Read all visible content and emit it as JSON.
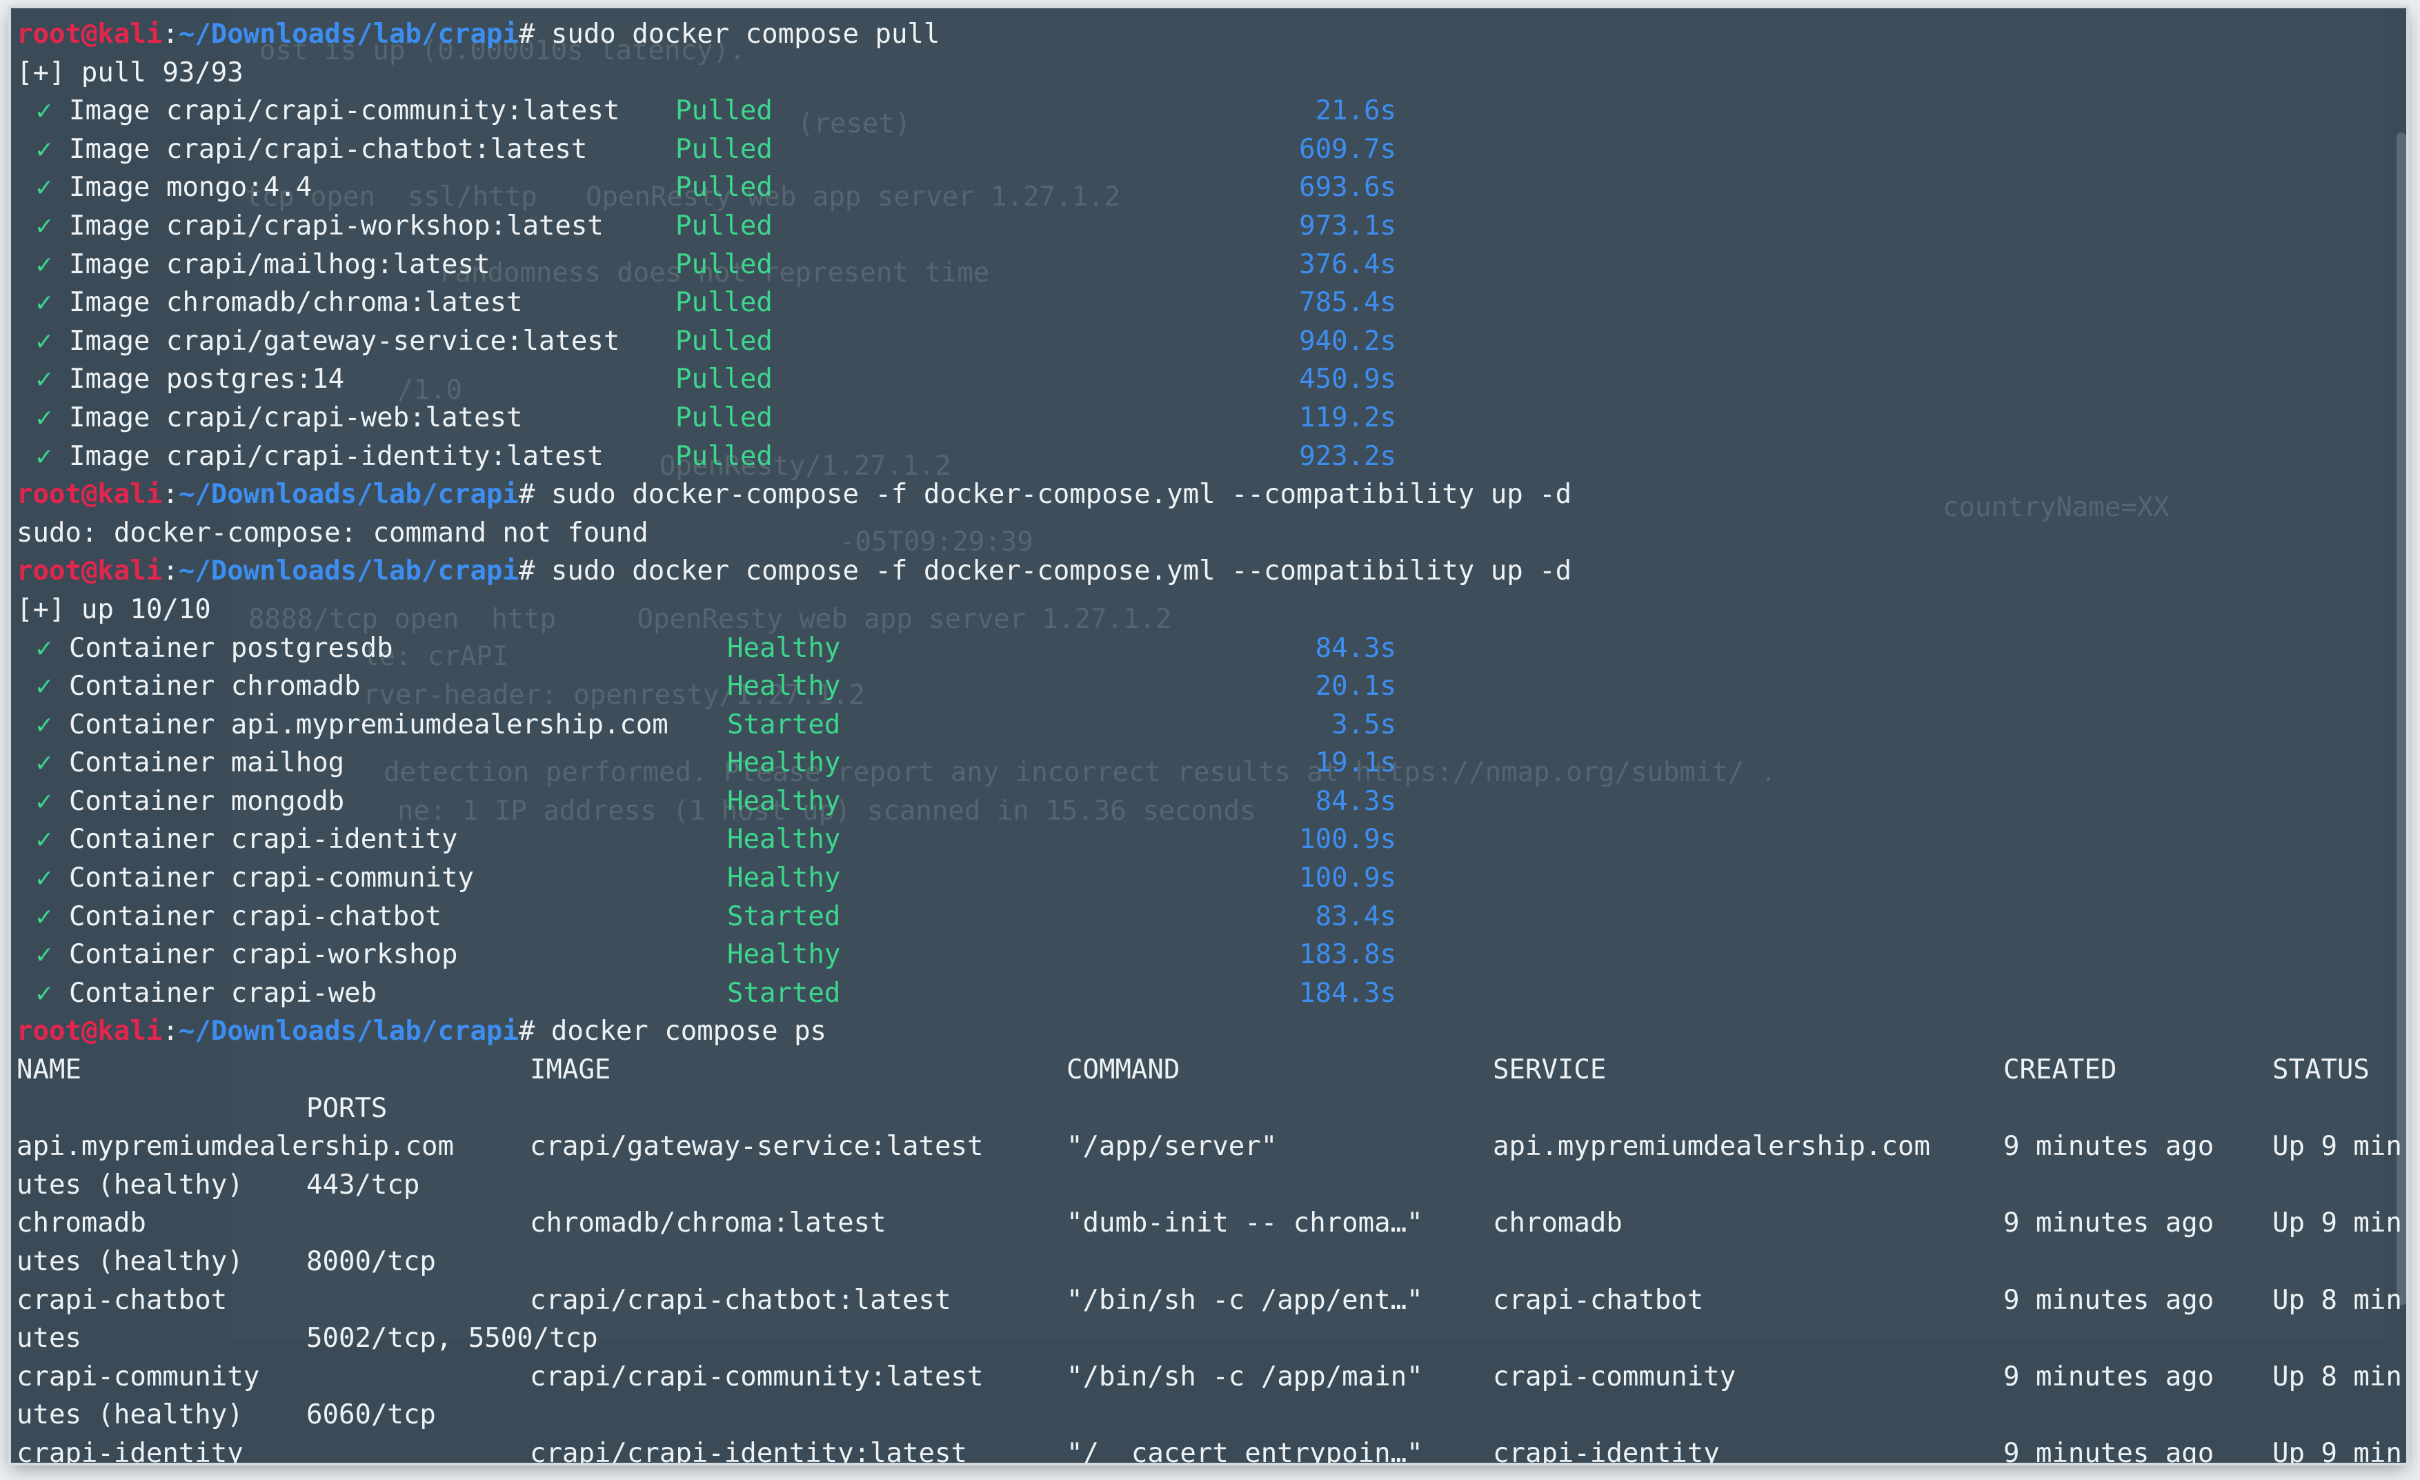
{
  "prompt": {
    "user": "root@kali",
    "sep": ":",
    "path": "~/Downloads/lab/crapi",
    "hash": "#"
  },
  "cmd1": " sudo docker compose pull",
  "pull_summary": "[+] pull 93/93",
  "pulled_images": [
    {
      "name": "Image crapi/crapi-community:latest",
      "status": "Pulled",
      "time": "21.6s"
    },
    {
      "name": "Image crapi/crapi-chatbot:latest",
      "status": "Pulled",
      "time": "609.7s"
    },
    {
      "name": "Image mongo:4.4",
      "status": "Pulled",
      "time": "693.6s"
    },
    {
      "name": "Image crapi/crapi-workshop:latest",
      "status": "Pulled",
      "time": "973.1s"
    },
    {
      "name": "Image crapi/mailhog:latest",
      "status": "Pulled",
      "time": "376.4s"
    },
    {
      "name": "Image chromadb/chroma:latest",
      "status": "Pulled",
      "time": "785.4s"
    },
    {
      "name": "Image crapi/gateway-service:latest",
      "status": "Pulled",
      "time": "940.2s"
    },
    {
      "name": "Image postgres:14",
      "status": "Pulled",
      "time": "450.9s"
    },
    {
      "name": "Image crapi/crapi-web:latest",
      "status": "Pulled",
      "time": "119.2s"
    },
    {
      "name": "Image crapi/crapi-identity:latest",
      "status": "Pulled",
      "time": "923.2s"
    }
  ],
  "cmd2": " sudo docker-compose -f docker-compose.yml --compatibility up -d",
  "error_line": "sudo: docker-compose: command not found",
  "cmd3": " sudo docker compose -f docker-compose.yml --compatibility up -d",
  "up_summary": "[+] up 10/10",
  "containers": [
    {
      "name": "Container postgresdb",
      "status": "Healthy",
      "time": "84.3s"
    },
    {
      "name": "Container chromadb",
      "status": "Healthy",
      "time": "20.1s"
    },
    {
      "name": "Container api.mypremiumdealership.com",
      "status": "Started",
      "time": "3.5s"
    },
    {
      "name": "Container mailhog",
      "status": "Healthy",
      "time": "19.1s"
    },
    {
      "name": "Container mongodb",
      "status": "Healthy",
      "time": "84.3s"
    },
    {
      "name": "Container crapi-identity",
      "status": "Healthy",
      "time": "100.9s"
    },
    {
      "name": "Container crapi-community",
      "status": "Healthy",
      "time": "100.9s"
    },
    {
      "name": "Container crapi-chatbot",
      "status": "Started",
      "time": "83.4s"
    },
    {
      "name": "Container crapi-workshop",
      "status": "Healthy",
      "time": "183.8s"
    },
    {
      "name": "Container crapi-web",
      "status": "Started",
      "time": "184.3s"
    }
  ],
  "cmd4": " docker compose ps",
  "check_mark": "✓",
  "ps_headers": {
    "name": "NAME",
    "image": "IMAGE",
    "command": "COMMAND",
    "service": "SERVICE",
    "created": "CREATED",
    "status": "STATUS",
    "ports": "PORTS"
  },
  "ps_rows": [
    {
      "name": "api.mypremiumdealership.com",
      "image": "crapi/gateway-service:latest",
      "command": "\"/app/server\"",
      "service": "api.mypremiumdealership.com",
      "created": "9 minutes ago",
      "status": "Up 9 min",
      "status_cont": "utes (healthy)",
      "ports": "443/tcp"
    },
    {
      "name": "chromadb",
      "image": "chromadb/chroma:latest",
      "command": "\"dumb-init -- chroma…\"",
      "service": "chromadb",
      "created": "9 minutes ago",
      "status": "Up 9 min",
      "status_cont": "utes (healthy)",
      "ports": "8000/tcp"
    },
    {
      "name": "crapi-chatbot",
      "image": "crapi/crapi-chatbot:latest",
      "command": "\"/bin/sh -c /app/ent…\"",
      "service": "crapi-chatbot",
      "created": "9 minutes ago",
      "status": "Up 8 min",
      "status_cont": "utes",
      "ports": "5002/tcp, 5500/tcp"
    },
    {
      "name": "crapi-community",
      "image": "crapi/crapi-community:latest",
      "command": "\"/bin/sh -c /app/main\"",
      "service": "crapi-community",
      "created": "9 minutes ago",
      "status": "Up 8 min",
      "status_cont": "utes (healthy)",
      "ports": "6060/tcp"
    },
    {
      "name": "crapi-identity",
      "image": "crapi/crapi-identity:latest",
      "command": "\"/__cacert_entrypoin…\"",
      "service": "crapi-identity",
      "created": "9 minutes ago",
      "status": "Up 9 min",
      "status_cont": "",
      "ports": ""
    }
  ],
  "ghost_lines": [
    "ost is up (0.000010s latency).",
    "(reset)",
    "tcp open  ssl/http   OpenResty web app server 1.27.1.2",
    "randomness does not represent time",
    "/1.0",
    "OpenResty/1.27.1.2",
    "countryName=XX",
    "-05T09:29:39",
    "8888/tcp open  http     OpenResty web app server 1.27.1.2",
    "le: crAPI",
    "rver-header: openresty/1.27.1.2",
    "detection performed. Please report any incorrect results at https://nmap.org/submit/ .",
    "ne: 1 IP address (1 host up) scanned in 15.36 seconds"
  ]
}
